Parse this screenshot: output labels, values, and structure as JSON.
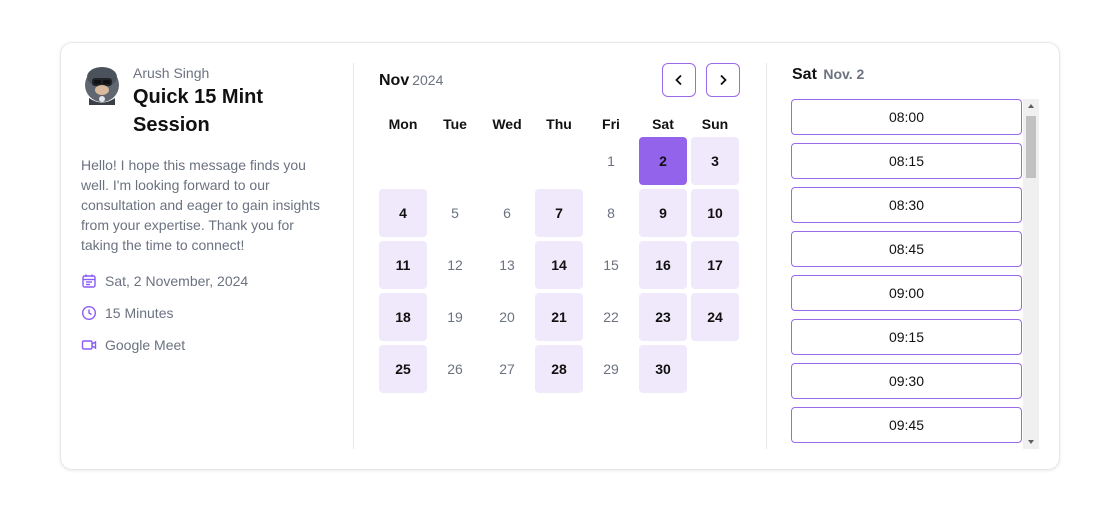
{
  "event": {
    "host_name": "Arush Singh",
    "title": "Quick 15 Mint Session",
    "description": "Hello! I hope this message finds you well. I'm looking forward to our consultation and eager to gain insights from your expertise. Thank you for taking the time to connect!",
    "date": "Sat, 2 November, 2024",
    "duration": "15 Minutes",
    "location": "Google Meet"
  },
  "calendar": {
    "month": "Nov",
    "year": "2024",
    "weekdays": [
      "Mon",
      "Tue",
      "Wed",
      "Thu",
      "Fri",
      "Sat",
      "Sun"
    ],
    "accent_color": "#9463ec",
    "available_color": "#efe9fb",
    "selected_day": "2",
    "days": [
      {
        "label": "",
        "state": "empty"
      },
      {
        "label": "",
        "state": "empty"
      },
      {
        "label": "",
        "state": "empty"
      },
      {
        "label": "",
        "state": "empty"
      },
      {
        "label": "1",
        "state": "disabled"
      },
      {
        "label": "2",
        "state": "selected"
      },
      {
        "label": "3",
        "state": "available"
      },
      {
        "label": "4",
        "state": "available"
      },
      {
        "label": "5",
        "state": "disabled"
      },
      {
        "label": "6",
        "state": "disabled"
      },
      {
        "label": "7",
        "state": "available"
      },
      {
        "label": "8",
        "state": "disabled"
      },
      {
        "label": "9",
        "state": "available"
      },
      {
        "label": "10",
        "state": "available"
      },
      {
        "label": "11",
        "state": "available"
      },
      {
        "label": "12",
        "state": "disabled"
      },
      {
        "label": "13",
        "state": "disabled"
      },
      {
        "label": "14",
        "state": "available"
      },
      {
        "label": "15",
        "state": "disabled"
      },
      {
        "label": "16",
        "state": "available"
      },
      {
        "label": "17",
        "state": "available"
      },
      {
        "label": "18",
        "state": "available"
      },
      {
        "label": "19",
        "state": "disabled"
      },
      {
        "label": "20",
        "state": "disabled"
      },
      {
        "label": "21",
        "state": "available"
      },
      {
        "label": "22",
        "state": "disabled"
      },
      {
        "label": "23",
        "state": "available"
      },
      {
        "label": "24",
        "state": "available"
      },
      {
        "label": "25",
        "state": "available"
      },
      {
        "label": "26",
        "state": "disabled"
      },
      {
        "label": "27",
        "state": "disabled"
      },
      {
        "label": "28",
        "state": "available"
      },
      {
        "label": "29",
        "state": "disabled"
      },
      {
        "label": "30",
        "state": "available"
      }
    ]
  },
  "times": {
    "day_name": "Sat",
    "date_short": "Nov. 2",
    "slots": [
      "08:00",
      "08:15",
      "08:30",
      "08:45",
      "09:00",
      "09:15",
      "09:30",
      "09:45"
    ]
  },
  "icons": {
    "prev": "chevron-left-icon",
    "next": "chevron-right-icon",
    "date": "calendar-icon",
    "duration": "clock-icon",
    "location": "video-icon"
  }
}
